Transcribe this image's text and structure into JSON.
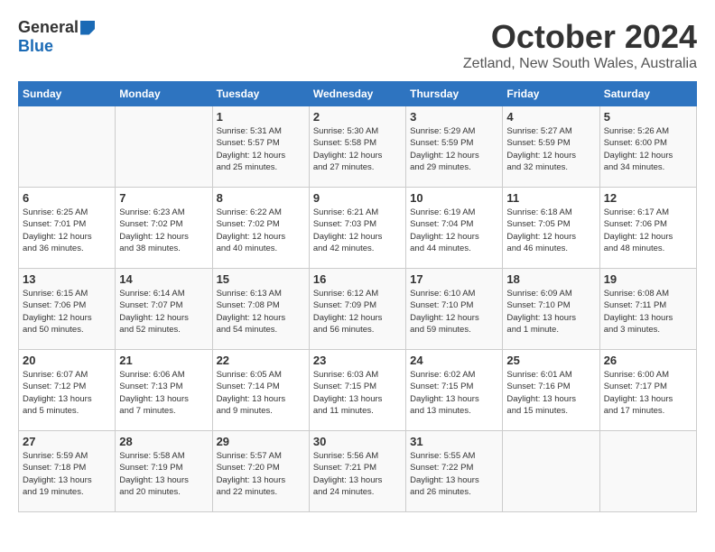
{
  "header": {
    "logo_general": "General",
    "logo_blue": "Blue",
    "month_title": "October 2024",
    "location": "Zetland, New South Wales, Australia"
  },
  "days_of_week": [
    "Sunday",
    "Monday",
    "Tuesday",
    "Wednesday",
    "Thursday",
    "Friday",
    "Saturday"
  ],
  "weeks": [
    [
      {
        "day": "",
        "info": ""
      },
      {
        "day": "",
        "info": ""
      },
      {
        "day": "1",
        "info": "Sunrise: 5:31 AM\nSunset: 5:57 PM\nDaylight: 12 hours\nand 25 minutes."
      },
      {
        "day": "2",
        "info": "Sunrise: 5:30 AM\nSunset: 5:58 PM\nDaylight: 12 hours\nand 27 minutes."
      },
      {
        "day": "3",
        "info": "Sunrise: 5:29 AM\nSunset: 5:59 PM\nDaylight: 12 hours\nand 29 minutes."
      },
      {
        "day": "4",
        "info": "Sunrise: 5:27 AM\nSunset: 5:59 PM\nDaylight: 12 hours\nand 32 minutes."
      },
      {
        "day": "5",
        "info": "Sunrise: 5:26 AM\nSunset: 6:00 PM\nDaylight: 12 hours\nand 34 minutes."
      }
    ],
    [
      {
        "day": "6",
        "info": "Sunrise: 6:25 AM\nSunset: 7:01 PM\nDaylight: 12 hours\nand 36 minutes."
      },
      {
        "day": "7",
        "info": "Sunrise: 6:23 AM\nSunset: 7:02 PM\nDaylight: 12 hours\nand 38 minutes."
      },
      {
        "day": "8",
        "info": "Sunrise: 6:22 AM\nSunset: 7:02 PM\nDaylight: 12 hours\nand 40 minutes."
      },
      {
        "day": "9",
        "info": "Sunrise: 6:21 AM\nSunset: 7:03 PM\nDaylight: 12 hours\nand 42 minutes."
      },
      {
        "day": "10",
        "info": "Sunrise: 6:19 AM\nSunset: 7:04 PM\nDaylight: 12 hours\nand 44 minutes."
      },
      {
        "day": "11",
        "info": "Sunrise: 6:18 AM\nSunset: 7:05 PM\nDaylight: 12 hours\nand 46 minutes."
      },
      {
        "day": "12",
        "info": "Sunrise: 6:17 AM\nSunset: 7:06 PM\nDaylight: 12 hours\nand 48 minutes."
      }
    ],
    [
      {
        "day": "13",
        "info": "Sunrise: 6:15 AM\nSunset: 7:06 PM\nDaylight: 12 hours\nand 50 minutes."
      },
      {
        "day": "14",
        "info": "Sunrise: 6:14 AM\nSunset: 7:07 PM\nDaylight: 12 hours\nand 52 minutes."
      },
      {
        "day": "15",
        "info": "Sunrise: 6:13 AM\nSunset: 7:08 PM\nDaylight: 12 hours\nand 54 minutes."
      },
      {
        "day": "16",
        "info": "Sunrise: 6:12 AM\nSunset: 7:09 PM\nDaylight: 12 hours\nand 56 minutes."
      },
      {
        "day": "17",
        "info": "Sunrise: 6:10 AM\nSunset: 7:10 PM\nDaylight: 12 hours\nand 59 minutes."
      },
      {
        "day": "18",
        "info": "Sunrise: 6:09 AM\nSunset: 7:10 PM\nDaylight: 13 hours\nand 1 minute."
      },
      {
        "day": "19",
        "info": "Sunrise: 6:08 AM\nSunset: 7:11 PM\nDaylight: 13 hours\nand 3 minutes."
      }
    ],
    [
      {
        "day": "20",
        "info": "Sunrise: 6:07 AM\nSunset: 7:12 PM\nDaylight: 13 hours\nand 5 minutes."
      },
      {
        "day": "21",
        "info": "Sunrise: 6:06 AM\nSunset: 7:13 PM\nDaylight: 13 hours\nand 7 minutes."
      },
      {
        "day": "22",
        "info": "Sunrise: 6:05 AM\nSunset: 7:14 PM\nDaylight: 13 hours\nand 9 minutes."
      },
      {
        "day": "23",
        "info": "Sunrise: 6:03 AM\nSunset: 7:15 PM\nDaylight: 13 hours\nand 11 minutes."
      },
      {
        "day": "24",
        "info": "Sunrise: 6:02 AM\nSunset: 7:15 PM\nDaylight: 13 hours\nand 13 minutes."
      },
      {
        "day": "25",
        "info": "Sunrise: 6:01 AM\nSunset: 7:16 PM\nDaylight: 13 hours\nand 15 minutes."
      },
      {
        "day": "26",
        "info": "Sunrise: 6:00 AM\nSunset: 7:17 PM\nDaylight: 13 hours\nand 17 minutes."
      }
    ],
    [
      {
        "day": "27",
        "info": "Sunrise: 5:59 AM\nSunset: 7:18 PM\nDaylight: 13 hours\nand 19 minutes."
      },
      {
        "day": "28",
        "info": "Sunrise: 5:58 AM\nSunset: 7:19 PM\nDaylight: 13 hours\nand 20 minutes."
      },
      {
        "day": "29",
        "info": "Sunrise: 5:57 AM\nSunset: 7:20 PM\nDaylight: 13 hours\nand 22 minutes."
      },
      {
        "day": "30",
        "info": "Sunrise: 5:56 AM\nSunset: 7:21 PM\nDaylight: 13 hours\nand 24 minutes."
      },
      {
        "day": "31",
        "info": "Sunrise: 5:55 AM\nSunset: 7:22 PM\nDaylight: 13 hours\nand 26 minutes."
      },
      {
        "day": "",
        "info": ""
      },
      {
        "day": "",
        "info": ""
      }
    ]
  ]
}
